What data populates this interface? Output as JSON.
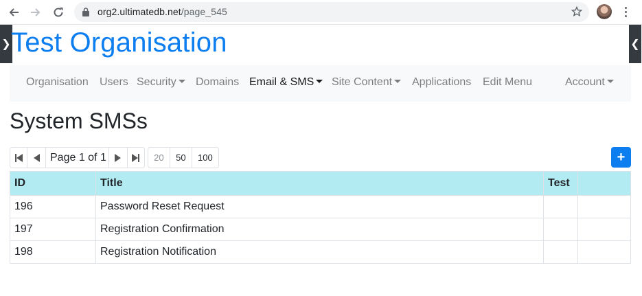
{
  "browser": {
    "url_host": "org2.ultimatedb.net",
    "url_path": "/page_545"
  },
  "app": {
    "title": "Test Organisation"
  },
  "navbar": {
    "items": [
      {
        "label": "Organisation",
        "dropdown": false,
        "active": false
      },
      {
        "label": "Users",
        "dropdown": false,
        "active": false
      },
      {
        "label": "Security",
        "dropdown": true,
        "active": false
      },
      {
        "label": "Domains",
        "dropdown": false,
        "active": false
      },
      {
        "label": "Email & SMS",
        "dropdown": true,
        "active": true
      },
      {
        "label": "Site Content",
        "dropdown": true,
        "active": false
      },
      {
        "label": "Applications",
        "dropdown": false,
        "active": false
      },
      {
        "label": "Edit Menu",
        "dropdown": false,
        "active": false
      },
      {
        "label": "Account",
        "dropdown": true,
        "active": false
      }
    ]
  },
  "page": {
    "heading": "System SMSs"
  },
  "pager": {
    "label": "Page 1 of 1",
    "page_sizes": [
      "20",
      "50",
      "100"
    ],
    "selected_size": "20"
  },
  "table": {
    "headers": [
      "ID",
      "Title",
      "Test",
      ""
    ],
    "rows": [
      {
        "id": "196",
        "title": "Password Reset Request"
      },
      {
        "id": "197",
        "title": "Registration Confirmation"
      },
      {
        "id": "198",
        "title": "Registration Notification"
      }
    ]
  },
  "icons": {
    "add": "plus-icon",
    "first": "first-page-icon",
    "prev": "prev-page-icon",
    "next": "next-page-icon",
    "last": "last-page-icon"
  },
  "colors": {
    "brand": "#0d7ef0",
    "table_header": "#b2ebf2",
    "navbar_bg": "#f8f9fa"
  }
}
